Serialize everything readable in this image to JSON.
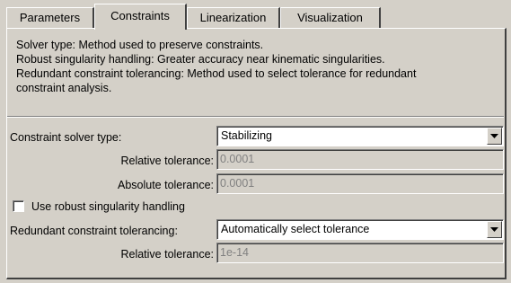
{
  "tabs": [
    {
      "label": "Parameters",
      "selected": false
    },
    {
      "label": "Constraints",
      "selected": true
    },
    {
      "label": "Linearization",
      "selected": false
    },
    {
      "label": "Visualization",
      "selected": false
    }
  ],
  "description": {
    "line1": "Solver type: Method used to preserve constraints.",
    "line2": "Robust singularity handling: Greater accuracy near kinematic singularities.",
    "line3": "Redundant constraint tolerancing: Method used to select tolerance for redundant",
    "line4": "constraint analysis."
  },
  "solver": {
    "label": "Constraint solver type:",
    "value": "Stabilizing"
  },
  "relative_tolerance": {
    "label": "Relative tolerance:",
    "value": "0.0001"
  },
  "absolute_tolerance": {
    "label": "Absolute tolerance:",
    "value": "0.0001"
  },
  "robust": {
    "label": "Use robust singularity handling",
    "checked": false
  },
  "redundant": {
    "label": "Redundant constraint tolerancing:",
    "value": "Automatically select tolerance"
  },
  "redundant_relative_tolerance": {
    "label": "Relative tolerance:",
    "value": "1e-14"
  },
  "icons": {
    "dropdown": "chevron-down-icon"
  }
}
